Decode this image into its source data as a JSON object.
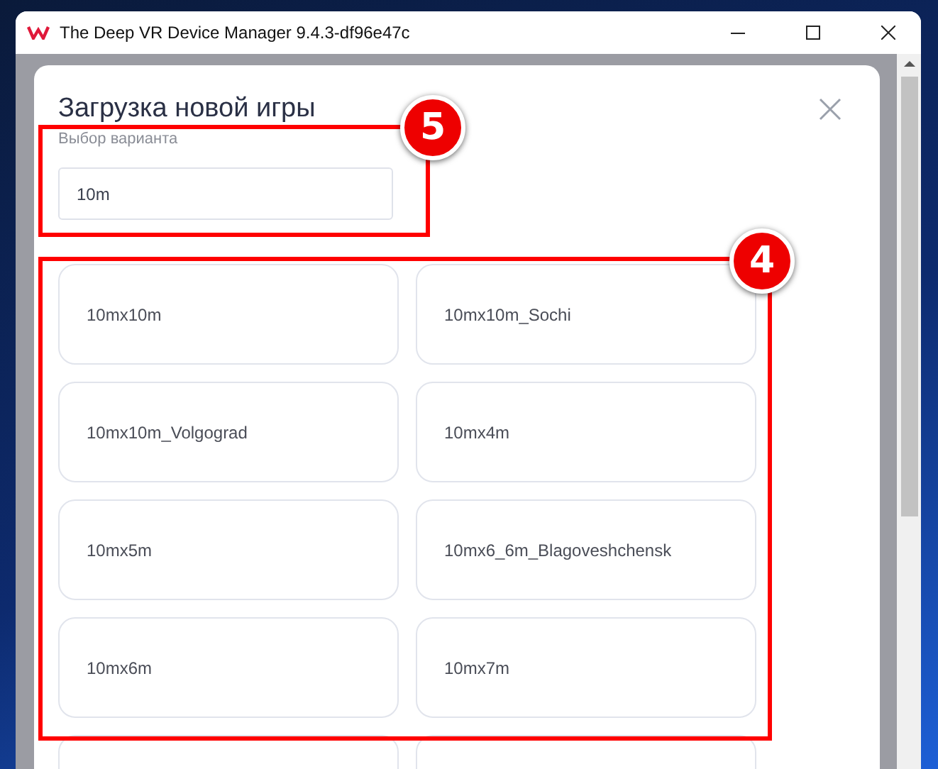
{
  "window": {
    "title": "The Deep VR Device Manager 9.4.3-df96e47c"
  },
  "dialog": {
    "title": "Загрузка новой игры",
    "variant_label": "Выбор варианта",
    "search": {
      "value": "10m"
    },
    "search_annotation": "5",
    "options_annotation": "4",
    "options": [
      {
        "label": "10mx10m"
      },
      {
        "label": "10mx10m_Sochi"
      },
      {
        "label": "10mx10m_Volgograd"
      },
      {
        "label": "10mx4m"
      },
      {
        "label": "10mx5m"
      },
      {
        "label": "10mx6_6m_Blagoveshchensk"
      },
      {
        "label": "10mx6m"
      },
      {
        "label": "10mx7m"
      }
    ]
  }
}
